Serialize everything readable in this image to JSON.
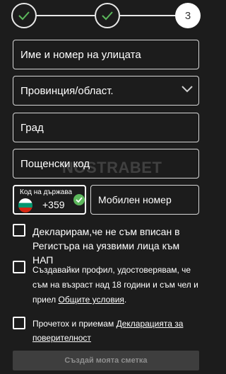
{
  "stepper": {
    "steps": [
      {
        "state": "done",
        "icon": "check-icon"
      },
      {
        "state": "done",
        "icon": "check-icon"
      },
      {
        "state": "current",
        "label": "3"
      }
    ],
    "check_color": "#5cb85c"
  },
  "form": {
    "street_placeholder": "Име и номер на улицата",
    "province_placeholder": "Провинция/област.",
    "city_placeholder": "Град",
    "postal_placeholder": "Пощенски код",
    "country_code_label": "Код на държава...",
    "country_code_value": "+359",
    "mobile_placeholder": "Мобилен номер"
  },
  "watermark": "NOSTRABET",
  "consents": {
    "pep_text": "Декларирам,че не съм вписан в Регистъра на уязвими лица към НАП",
    "age_text_before": "Създавайки профил, удостоверявам, че съм на възраст над 18 години и съм чел и приел ",
    "age_link": "Общите условия",
    "age_text_after": ".",
    "privacy_text_before": "Прочетох и приемам ",
    "privacy_link": "Декларацията за поверителност"
  },
  "submit_label": "Създай моята сметка"
}
